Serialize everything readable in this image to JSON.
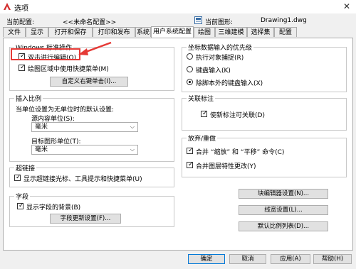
{
  "window": {
    "title": "选项",
    "close_glyph": "✕"
  },
  "header": {
    "current_profile_label": "当前配置:",
    "current_profile_value": "<<未命名配置>>",
    "current_drawing_label": "当前图形:",
    "current_drawing_value": "Drawing1.dwg"
  },
  "tabs": [
    "文件",
    "显示",
    "打开和保存",
    "打印和发布",
    "系统",
    "用户系统配置",
    "绘图",
    "三维建模",
    "选择集",
    "配置"
  ],
  "windows_std": {
    "title": "Windows 标准操作",
    "dblclick_label": "双击进行编辑(O)",
    "shortcut_menu_label": "绘图区域中使用快捷菜单(M)",
    "custom_right_click_button": "自定义右键单击(I)..."
  },
  "insert_scale": {
    "title": "插入比例",
    "desc": "当单位设置为无单位时的默认设置:",
    "source_label": "源内容单位(S):",
    "source_value": "毫米",
    "target_label": "目标图形单位(T):",
    "target_value": "毫米"
  },
  "hyperlink": {
    "title": "超链接",
    "label": "显示超链接光标、工具提示和快捷菜单(U)"
  },
  "fields": {
    "title": "字段",
    "bg_label": "显示字段的背景(B)",
    "button": "字段更新设置(F)..."
  },
  "coord_priority": {
    "title": "坐标数据输入的优先级",
    "options": [
      "执行对象捕捉(R)",
      "键盘输入(K)",
      "除脚本外的键盘输入(X)"
    ],
    "selected_index": 2
  },
  "associative_dim": {
    "title": "关联标注",
    "label": "使新标注可关联(D)"
  },
  "undo_redo": {
    "title": "放弃/重做",
    "zoom_pan_label": "合并 “缩放” 和 “平移” 命令(C)",
    "layer_prop_label": "合并图层特性更改(Y)"
  },
  "side_buttons": {
    "block_editor": "块编辑器设置(N)...",
    "lineweight": "线宽设置(L)...",
    "scale_list": "默认比例列表(D)..."
  },
  "footer": {
    "ok": "确定",
    "cancel": "取消",
    "apply": "应用(A)",
    "help": "帮助(H)"
  },
  "colors": {
    "accent": "#0078d7",
    "callout": "#e53935",
    "app_icon": "#d32f2f"
  }
}
